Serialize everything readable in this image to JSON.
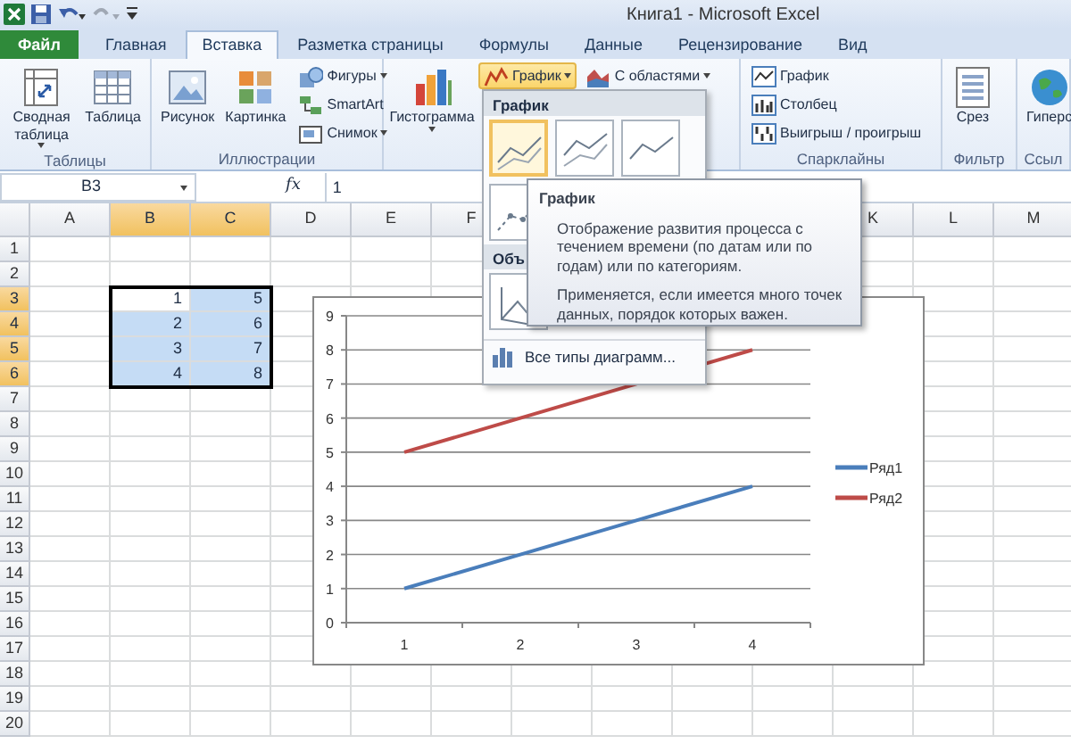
{
  "window": {
    "title": "Книга1  -  Microsoft Excel"
  },
  "tabs": [
    {
      "label": "Файл",
      "kind": "file",
      "selected": false
    },
    {
      "label": "Главная",
      "kind": "tab",
      "selected": false
    },
    {
      "label": "Вставка",
      "kind": "tab",
      "selected": true
    },
    {
      "label": "Разметка страницы",
      "kind": "tab",
      "selected": false
    },
    {
      "label": "Формулы",
      "kind": "tab",
      "selected": false
    },
    {
      "label": "Данные",
      "kind": "tab",
      "selected": false
    },
    {
      "label": "Рецензирование",
      "kind": "tab",
      "selected": false
    },
    {
      "label": "Вид",
      "kind": "tab",
      "selected": false
    }
  ],
  "ribbon": {
    "groups": [
      {
        "label": "Таблицы",
        "items": [
          {
            "kind": "large",
            "label": "Сводная таблица",
            "dropdown": true
          },
          {
            "kind": "large",
            "label": "Таблица",
            "dropdown": false
          }
        ]
      },
      {
        "label": "Иллюстрации",
        "items": [
          {
            "kind": "large",
            "label": "Рисунок",
            "dropdown": false
          },
          {
            "kind": "large",
            "label": "Картинка",
            "dropdown": false
          },
          {
            "kind": "small",
            "label": "Фигуры",
            "dropdown": true
          },
          {
            "kind": "small",
            "label": "SmartArt",
            "dropdown": false
          },
          {
            "kind": "small",
            "label": "Снимок",
            "dropdown": true
          }
        ]
      },
      {
        "items": [
          {
            "kind": "large",
            "label": "Гистограмма",
            "dropdown": true
          },
          {
            "kind": "small",
            "label": "График",
            "dropdown": true,
            "pressed": true
          },
          {
            "kind": "small",
            "label": "С областями",
            "dropdown": true
          }
        ]
      },
      {
        "label": "Спарклайны",
        "items": [
          {
            "kind": "small",
            "label": "График",
            "dropdown": false
          },
          {
            "kind": "small",
            "label": "Столбец",
            "dropdown": false
          },
          {
            "kind": "small",
            "label": "Выигрыш / проигрыш",
            "dropdown": false
          }
        ]
      },
      {
        "label": "Фильтр",
        "items": [
          {
            "kind": "large",
            "label": "Срез",
            "dropdown": false
          }
        ]
      },
      {
        "label": "Ссыл",
        "items": [
          {
            "kind": "large",
            "label": "Гиперс",
            "dropdown": false
          }
        ]
      }
    ]
  },
  "formula_bar": {
    "name_box": "B3",
    "fx": "fx",
    "value": "1"
  },
  "sheet": {
    "columns": [
      {
        "label": "A",
        "selected": false
      },
      {
        "label": "B",
        "selected": true
      },
      {
        "label": "C",
        "selected": true
      },
      {
        "label": "D",
        "selected": false
      },
      {
        "label": "E",
        "selected": false
      },
      {
        "label": "F",
        "selected": false
      },
      {
        "label": "K",
        "selected": false
      },
      {
        "label": "L",
        "selected": false
      },
      {
        "label": "M",
        "selected": false
      }
    ],
    "rows": [
      {
        "label": "1",
        "selected": false
      },
      {
        "label": "2",
        "selected": false
      },
      {
        "label": "3",
        "selected": true
      },
      {
        "label": "4",
        "selected": true
      },
      {
        "label": "5",
        "selected": true
      },
      {
        "label": "6",
        "selected": true
      },
      {
        "label": "7",
        "selected": false
      },
      {
        "label": "8",
        "selected": false
      },
      {
        "label": "9",
        "selected": false
      },
      {
        "label": "10",
        "selected": false
      },
      {
        "label": "11",
        "selected": false
      },
      {
        "label": "12",
        "selected": false
      },
      {
        "label": "13",
        "selected": false
      },
      {
        "label": "14",
        "selected": false
      },
      {
        "label": "15",
        "selected": false
      },
      {
        "label": "16",
        "selected": false
      },
      {
        "label": "17",
        "selected": false
      },
      {
        "label": "18",
        "selected": false
      },
      {
        "label": "19",
        "selected": false
      },
      {
        "label": "20",
        "selected": false
      }
    ],
    "data": [
      [
        "1",
        "5"
      ],
      [
        "2",
        "6"
      ],
      [
        "3",
        "7"
      ],
      [
        "4",
        "8"
      ]
    ]
  },
  "chart": {
    "chart_data": {
      "type": "line",
      "categories": [
        "1",
        "2",
        "3",
        "4"
      ],
      "series": [
        {
          "name": "Ряд1",
          "color": "#4a7ebb",
          "values": [
            1,
            2,
            3,
            4
          ]
        },
        {
          "name": "Ряд2",
          "color": "#be4b48",
          "values": [
            5,
            6,
            7,
            8
          ]
        }
      ],
      "ylim": [
        0,
        9
      ],
      "yticks": [
        0,
        1,
        2,
        3,
        4,
        5,
        6,
        7,
        8,
        9
      ],
      "grid": true,
      "legend": "right"
    }
  },
  "dropdown": {
    "sections": [
      {
        "title": "График",
        "thumbnails": [
          {
            "selected": true
          },
          {
            "selected": false
          },
          {
            "selected": false
          },
          {
            "selected": false
          }
        ]
      },
      {
        "title": "Объ",
        "thumbnails": [
          {
            "selected": false
          }
        ]
      }
    ],
    "footer": "Все типы диаграмм..."
  },
  "tooltip": {
    "title": "График",
    "paragraphs": [
      "Отображение развития процесса с течением времени (по датам или по годам) или по категориям.",
      "Применяется, если имеется много точек данных, порядок которых важен."
    ]
  }
}
